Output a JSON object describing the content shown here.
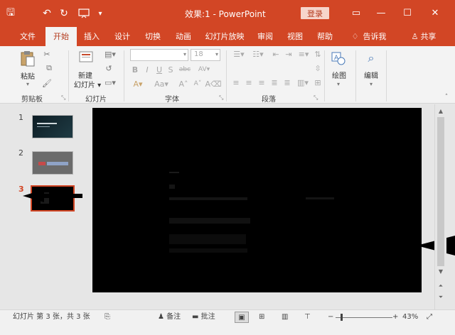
{
  "titlebar": {
    "document_title": "效果:1 - PowerPoint",
    "login_label": "登录",
    "qa_save": "🖫",
    "qa_undo": "↶",
    "qa_redo": "↻",
    "qa_custom": "▾",
    "btn_ribbon": "▭",
    "btn_min": "—",
    "btn_max": "☐",
    "btn_close": "✕"
  },
  "tabs": [
    {
      "label": "文件"
    },
    {
      "label": "开始"
    },
    {
      "label": "插入"
    },
    {
      "label": "设计"
    },
    {
      "label": "切换"
    },
    {
      "label": "动画"
    },
    {
      "label": "幻灯片放映"
    },
    {
      "label": "审阅"
    },
    {
      "label": "视图"
    },
    {
      "label": "帮助"
    },
    {
      "label": "告诉我"
    },
    {
      "label": "共享"
    }
  ],
  "ribbon": {
    "clipboard": {
      "group": "剪贴板",
      "paste": "粘贴"
    },
    "slides": {
      "group": "幻灯片",
      "new_slide_1": "新建",
      "new_slide_2": "幻灯片 ▾"
    },
    "font": {
      "group": "字体",
      "font_size": "18"
    },
    "paragraph": {
      "group": "段落"
    },
    "drawing": {
      "label": "绘图"
    },
    "editing": {
      "label": "编辑"
    }
  },
  "slides_panel": {
    "numbers": [
      "1",
      "2",
      "3"
    ],
    "selected_index": 3
  },
  "status": {
    "slide_info": "幻灯片 第 3 张，共 3 张",
    "notes": "备注",
    "comments": "批注",
    "zoom": "43%"
  },
  "colors": {
    "accent": "#d24625",
    "ribbon_bg": "#f3f3f3",
    "slide_bg": "#000000"
  }
}
